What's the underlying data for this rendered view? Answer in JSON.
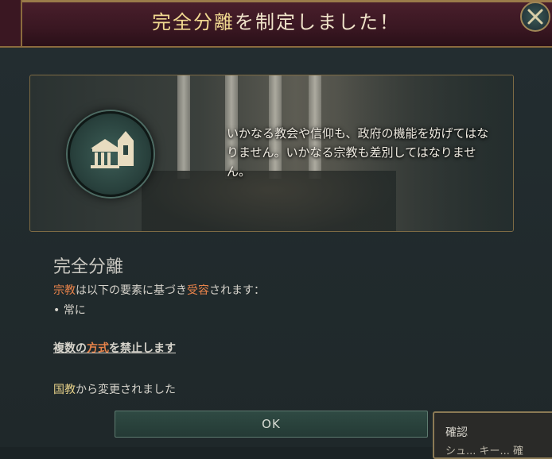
{
  "header": {
    "title_highlight": "完全分離",
    "title_rest": "を制定しました！"
  },
  "banner": {
    "description": "いかなる教会や信仰も、政府の機能を妨げてはなりません。いかなる宗教も差別してはなりません。"
  },
  "policy": {
    "name": "完全分離",
    "acceptance_religion": "宗教",
    "acceptance_middle": "は以下の要素に基づき",
    "acceptance_accepted": "受容",
    "acceptance_end": "されます：",
    "condition": "• 常に",
    "effect_prefix": "複数の",
    "effect_keyword": "方式",
    "effect_suffix": "を禁止します",
    "changed_from_name": "国教",
    "changed_from_suffix": "から変更されました"
  },
  "buttons": {
    "ok_label": "OK"
  },
  "tooltip": {
    "title": "確認",
    "subtitle": "シュ... キー... 確"
  },
  "icons": {
    "close": "close-icon",
    "emblem": "church-government-icon"
  },
  "colors": {
    "accent_orange": "#e8834a",
    "accent_yellow": "#e8d28a",
    "header_bg": "#3a1722",
    "border_gold": "#8b6b3d"
  }
}
